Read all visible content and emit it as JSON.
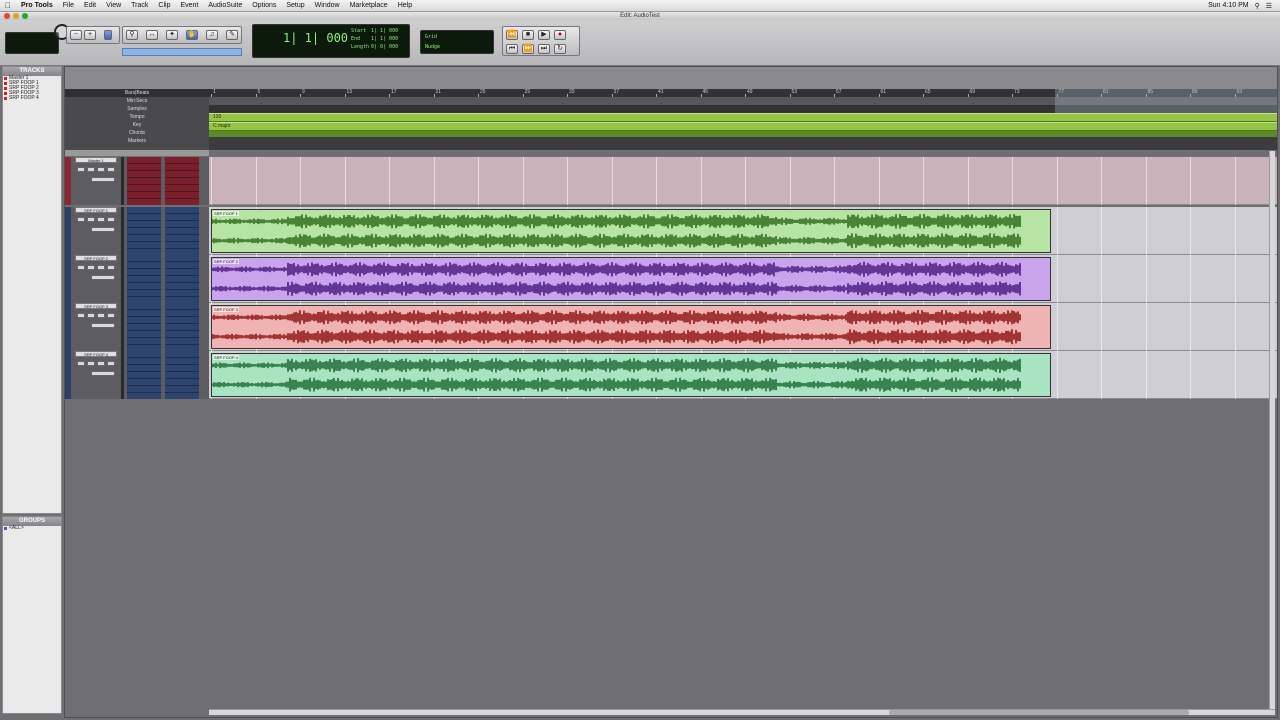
{
  "menubar": {
    "app": "Pro Tools",
    "items": [
      "File",
      "Edit",
      "View",
      "Track",
      "Clip",
      "Event",
      "AudioSuite",
      "Options",
      "Setup",
      "Window",
      "Marketplace",
      "Help"
    ],
    "clock": "Sun 4:10 PM"
  },
  "window": {
    "title": "Edit: AudioTest"
  },
  "toolbar": {
    "main_counter": "1| 1| 000",
    "counter_fields": [
      "Start",
      "End",
      "Length"
    ],
    "counter_values": [
      "1| 1| 000",
      "1| 1| 000",
      "0| 0| 000"
    ],
    "grid_label": "Grid",
    "nudge_label": "Nudge"
  },
  "tracks_list": {
    "title": "TRACKS",
    "items": [
      "Master 1",
      "SRP FOOP 1",
      "SRP FOOP 2",
      "SRP FOOP 3",
      "SRP FOOP 4"
    ]
  },
  "groups_list": {
    "title": "GROUPS",
    "items": [
      "<ALL>"
    ]
  },
  "rulers": {
    "labels": [
      "Bars|Beats",
      "Min:Secs",
      "Samples",
      "Tempo",
      "Key",
      "Chords",
      "Markers"
    ],
    "bars": [
      "1",
      "5",
      "9",
      "13",
      "17",
      "21",
      "25",
      "29",
      "33",
      "37",
      "41",
      "45",
      "49",
      "53",
      "57",
      "61",
      "65",
      "69",
      "73",
      "77",
      "81",
      "85",
      "89",
      "93"
    ],
    "tempo_marker": "120",
    "key_marker": "C major"
  },
  "tracks": [
    {
      "name": "Master 1",
      "kind": "master",
      "color": "#8b2433",
      "fill": "#c9aeb6",
      "wave": "#c9aeb6"
    },
    {
      "name": "SRP FOOP 1",
      "kind": "audio",
      "color": "#2c3f66",
      "fill": "#b7e4a4",
      "wave": "#2e6b1c",
      "clip": "SRP FOOP 1"
    },
    {
      "name": "SRP FOOP 2",
      "kind": "audio",
      "color": "#2c3f66",
      "fill": "#c9a3ec",
      "wave": "#4a1a80",
      "clip": "SRP FOOP 2"
    },
    {
      "name": "SRP FOOP 3",
      "kind": "audio",
      "color": "#2c3f66",
      "fill": "#efb3b3",
      "wave": "#8f1414",
      "clip": "SRP FOOP 3"
    },
    {
      "name": "SRP FOOP 4",
      "kind": "audio",
      "color": "#2c3f66",
      "fill": "#a9e3c2",
      "wave": "#1c6b33",
      "clip": "SRP FOOP 4"
    }
  ],
  "colors": {
    "background": "#6f6e72",
    "lcd_text": "#8df07a",
    "tempo_ruler": "#96c447"
  }
}
